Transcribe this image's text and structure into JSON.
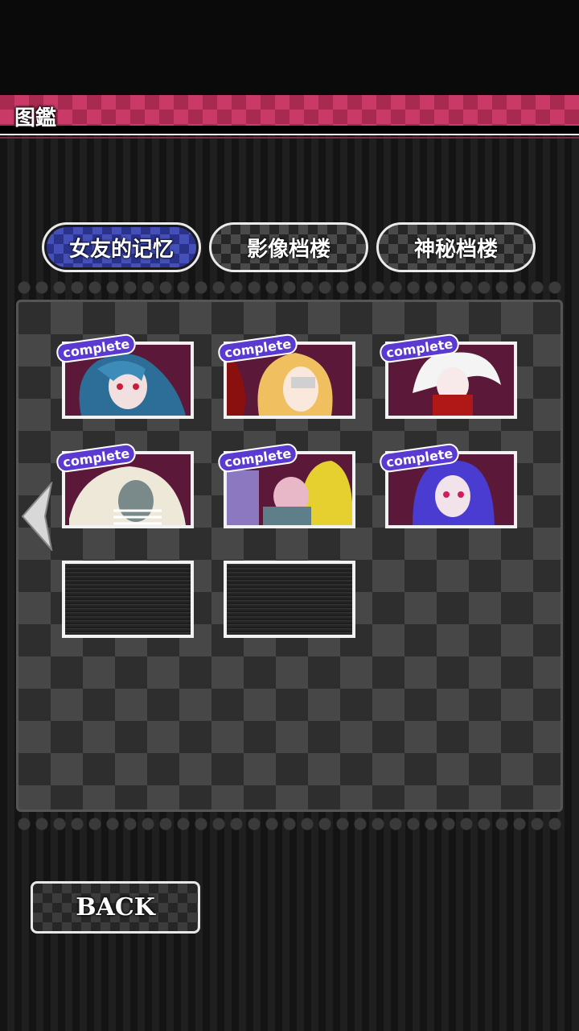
{
  "header": {
    "title": "图鑑"
  },
  "tabs": [
    {
      "label": "女友的记忆",
      "active": true
    },
    {
      "label": "影像档楼",
      "active": false
    },
    {
      "label": "神秘档楼",
      "active": false
    }
  ],
  "gallery": {
    "cards": [
      {
        "badge": "complete",
        "state": "complete",
        "hair": "blue"
      },
      {
        "badge": "complete",
        "state": "complete",
        "hair": "blonde"
      },
      {
        "badge": "complete",
        "state": "complete",
        "hair": "white"
      },
      {
        "badge": "complete",
        "state": "complete",
        "hair": "white-bandaged"
      },
      {
        "badge": "complete",
        "state": "complete",
        "hair": "blonde-puppet"
      },
      {
        "badge": "complete",
        "state": "complete",
        "hair": "purple"
      },
      {
        "badge": "",
        "state": "locked"
      },
      {
        "badge": "",
        "state": "locked"
      }
    ]
  },
  "footer": {
    "back_label": "BACK"
  },
  "colors": {
    "accent": "#c93a68",
    "badge": "#5a3ad0",
    "active_tab": "#2a328c"
  }
}
